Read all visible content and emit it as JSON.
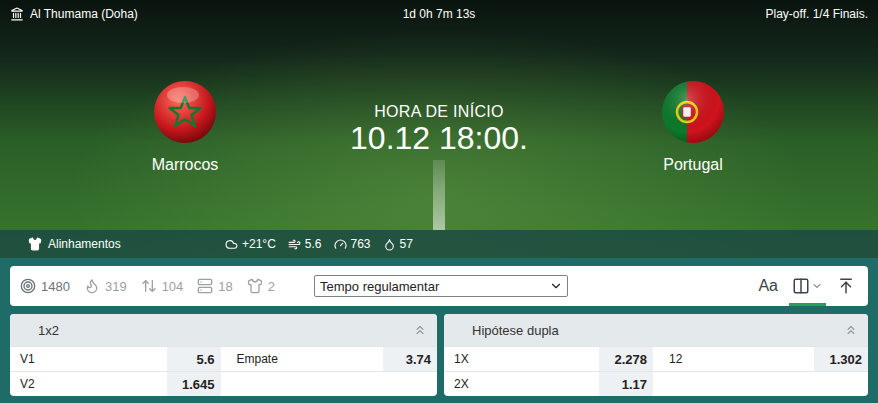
{
  "header": {
    "venue": "Al Thumama (Doha)",
    "countdown": "1d 0h 7m 13s",
    "stage": "Play-off. 1/4 Finais.",
    "start_label": "HORA DE INÍCIO",
    "start_time": "10.12 18:00."
  },
  "teams": [
    {
      "name": "Marrocos",
      "flag": "morocco"
    },
    {
      "name": "Portugal",
      "flag": "portugal"
    }
  ],
  "info_bar": {
    "lineups": "Alinhamentos",
    "weather": [
      {
        "kind": "temperature",
        "value": "+21°C"
      },
      {
        "kind": "wind",
        "value": "5.6"
      },
      {
        "kind": "pressure",
        "value": "763"
      },
      {
        "kind": "humidity",
        "value": "57"
      }
    ]
  },
  "filters": [
    {
      "kind": "all",
      "count": "1480",
      "selected": true
    },
    {
      "kind": "hot",
      "count": "319",
      "selected": false
    },
    {
      "kind": "totals",
      "count": "104",
      "selected": false
    },
    {
      "kind": "stats",
      "count": "18",
      "selected": false
    },
    {
      "kind": "players",
      "count": "2",
      "selected": false
    }
  ],
  "period_select": {
    "value": "Tempo regulamentar"
  },
  "view_tools": [
    {
      "kind": "font",
      "label": "Aa",
      "selected": false
    },
    {
      "kind": "columns",
      "selected": true
    },
    {
      "kind": "pin",
      "selected": false
    }
  ],
  "markets": [
    {
      "title": "1x2",
      "expanded": true,
      "rows": [
        [
          {
            "label": "V1",
            "odd": "5.6"
          },
          {
            "label": "Empate",
            "odd": "3.74"
          }
        ],
        [
          {
            "label": "V2",
            "odd": "1.645"
          }
        ]
      ]
    },
    {
      "title": "Hipótese dupla",
      "expanded": true,
      "rows": [
        [
          {
            "label": "1X",
            "odd": "2.278"
          },
          {
            "label": "12",
            "odd": "1.302"
          }
        ],
        [
          {
            "label": "2X",
            "odd": "1.17"
          }
        ]
      ]
    }
  ]
}
